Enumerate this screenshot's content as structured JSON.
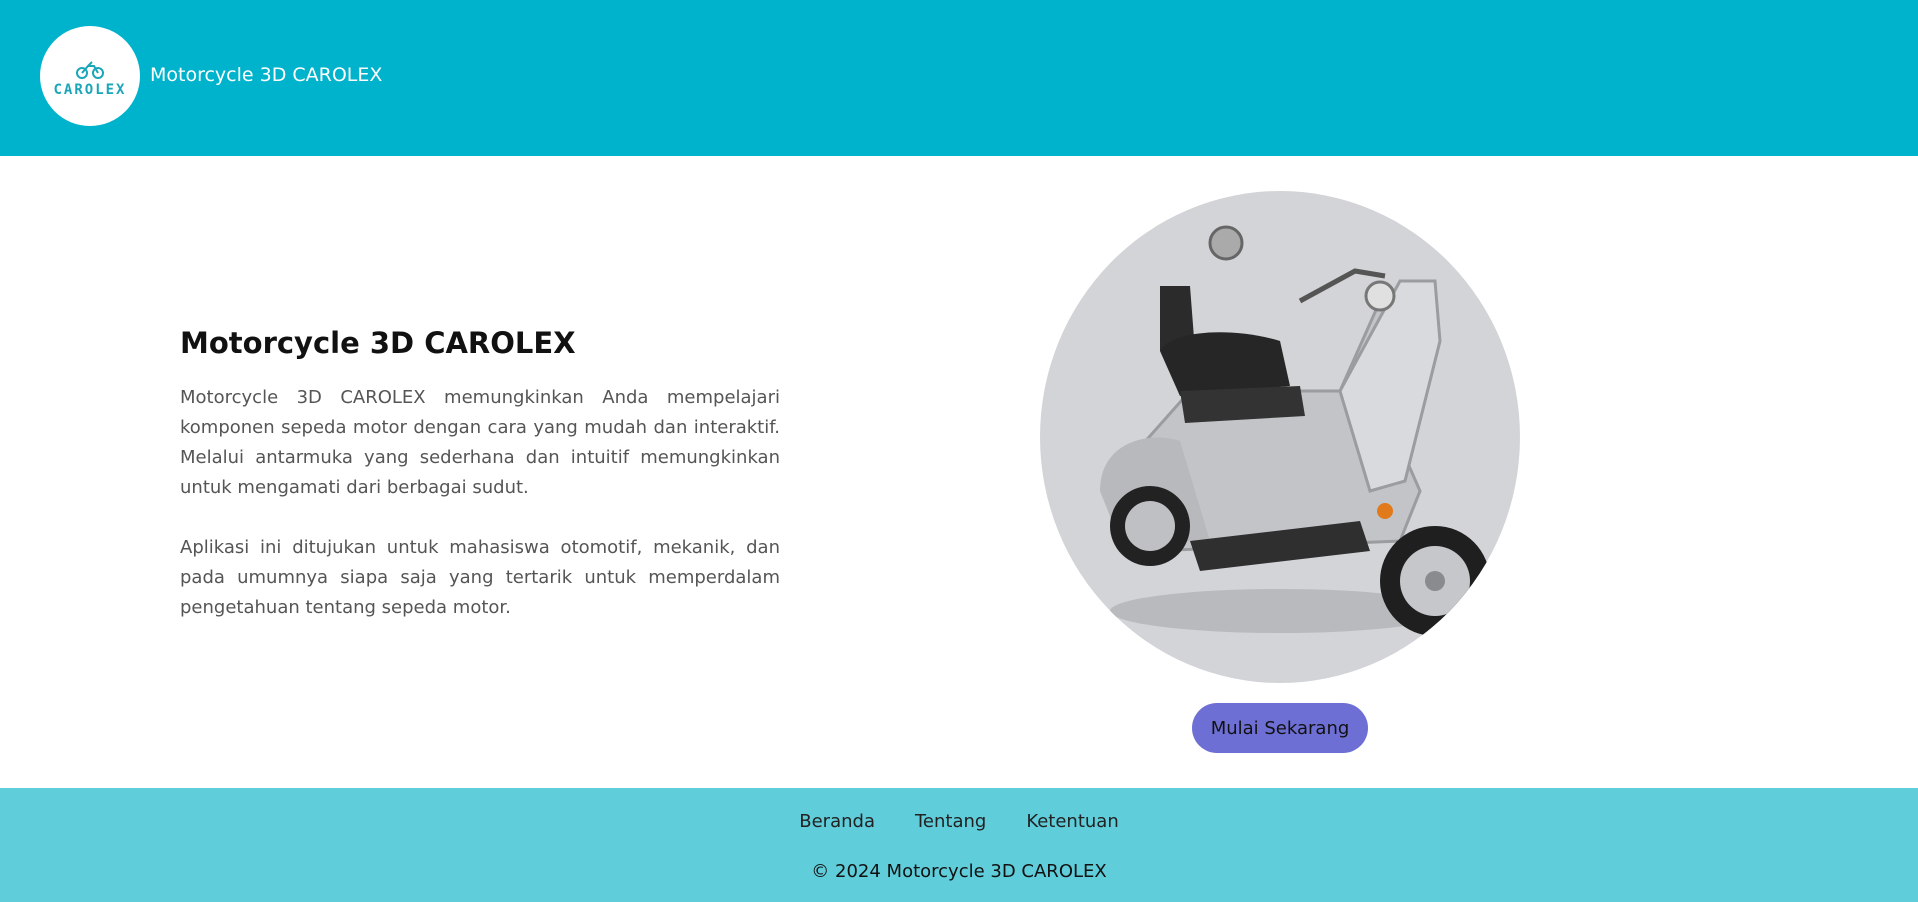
{
  "header": {
    "logo_text": "CAROLEX",
    "brand_title": "Motorcycle 3D CAROLEX"
  },
  "main": {
    "title": "Motorcycle 3D CAROLEX",
    "paragraph_1": "Motorcycle 3D CAROLEX memungkinkan Anda mempelajari komponen sepeda motor dengan cara yang mudah dan interaktif. Melalui antarmuka yang sederhana dan intuitif memungkinkan untuk mengamati dari berbagai sudut.",
    "paragraph_2": "Aplikasi ini ditujukan untuk mahasiswa otomotif, mekanik, dan pada umumnya siapa saja yang tertarik untuk memperdalam pengetahuan tentang sepeda motor.",
    "cta_label": "Mulai Sekarang",
    "hero_icon": "scooter-image"
  },
  "footer": {
    "nav": [
      "Beranda",
      "Tentang",
      "Ketentuan"
    ],
    "copyright": "© 2024 Motorcycle 3D CAROLEX"
  },
  "colors": {
    "header_bg": "#00b3cc",
    "footer_bg": "#5fcdda",
    "cta_bg": "#6e6fd4",
    "hero_bg": "#d3d4d8"
  }
}
